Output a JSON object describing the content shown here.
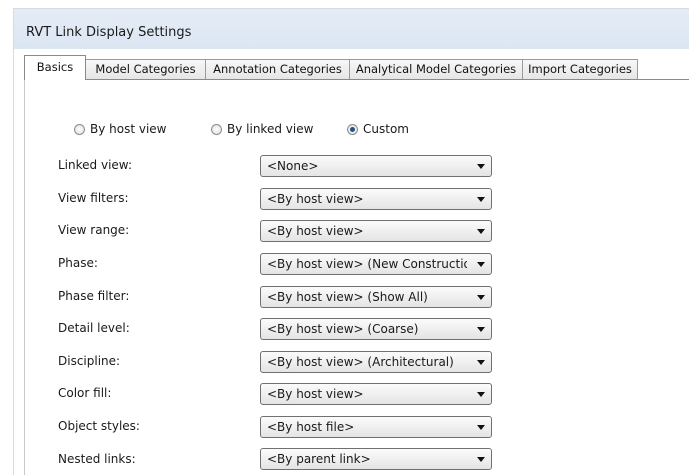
{
  "window": {
    "title": "RVT Link Display Settings"
  },
  "tabs": [
    {
      "label": "Basics",
      "active": true
    },
    {
      "label": "Model Categories",
      "active": false
    },
    {
      "label": "Annotation Categories",
      "active": false
    },
    {
      "label": "Analytical Model Categories",
      "active": false
    },
    {
      "label": "Import Categories",
      "active": false
    }
  ],
  "display_mode": {
    "options": [
      {
        "label": "By host view",
        "checked": false
      },
      {
        "label": "By linked view",
        "checked": false
      },
      {
        "label": "Custom",
        "checked": true
      }
    ]
  },
  "settings": [
    {
      "label": "Linked view:",
      "value": "<None>"
    },
    {
      "label": "View filters:",
      "value": "<By host view>"
    },
    {
      "label": "View range:",
      "value": "<By host view>"
    },
    {
      "label": "Phase:",
      "value": "<By host view> (New Construction)"
    },
    {
      "label": "Phase filter:",
      "value": "<By host view> (Show All)"
    },
    {
      "label": "Detail level:",
      "value": "<By host view> (Coarse)"
    },
    {
      "label": "Discipline:",
      "value": "<By host view> (Architectural)"
    },
    {
      "label": "Color fill:",
      "value": "<By host view>"
    },
    {
      "label": "Object styles:",
      "value": "<By host file>"
    },
    {
      "label": "Nested links:",
      "value": "<By parent link>"
    }
  ],
  "icons": {
    "dropdown": "chevron-down-icon",
    "radio": "radio-icon"
  }
}
